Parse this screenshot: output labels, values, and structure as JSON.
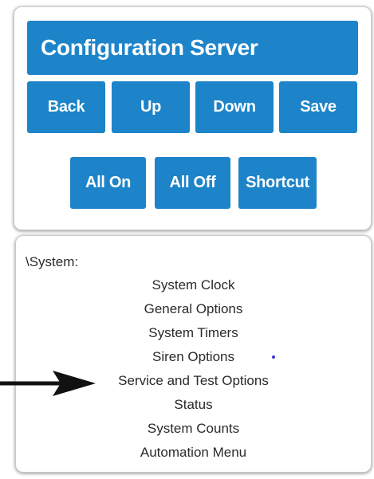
{
  "header": {
    "title": "Configuration Server"
  },
  "toolbar": {
    "row1": [
      "Back",
      "Up",
      "Down",
      "Save"
    ],
    "row2": [
      "All On",
      "All Off",
      "Shortcut"
    ]
  },
  "menu": {
    "path": "\\System:",
    "items": [
      "System Clock",
      "General Options",
      "System Timers",
      "Siren Options",
      "Service and Test Options",
      "Status",
      "System Counts",
      "Automation Menu"
    ]
  },
  "colors": {
    "accent": "#1d84c9",
    "text": "#2a2a2a",
    "arrow": "#111111"
  }
}
